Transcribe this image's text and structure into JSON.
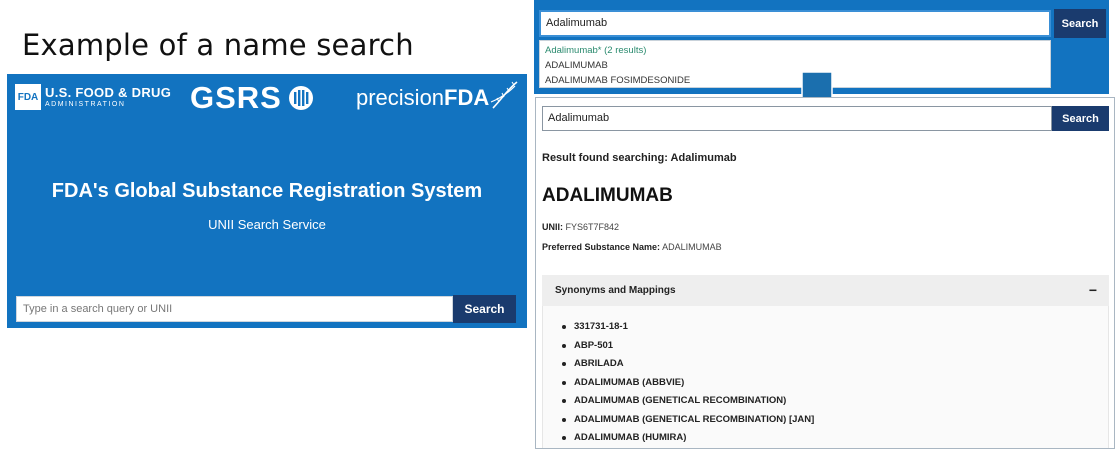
{
  "slide": {
    "title": "Example of a name search"
  },
  "home": {
    "fda_logo": {
      "box": "FDA",
      "line1": "U.S. FOOD & DRUG",
      "line2": "ADMINISTRATION"
    },
    "gsrs_logo": "GSRS",
    "precision_logo": {
      "thin": "precision",
      "bold": "FDA"
    },
    "heading": "FDA's Global Substance Registration System",
    "subheading": "UNII Search Service",
    "search": {
      "placeholder": "Type in a search query or UNII",
      "button": "Search"
    }
  },
  "autocomplete": {
    "query": "Adalimumab",
    "button": "Search",
    "header": "Adalimumab* (2 results)",
    "options": [
      "ADALIMUMAB",
      "ADALIMUMAB FOSIMDESONIDE"
    ]
  },
  "result": {
    "query": "Adalimumab",
    "button": "Search",
    "found_text": "Result found searching: Adalimumab",
    "name": "ADALIMUMAB",
    "unii_label": "UNII:",
    "unii_value": "FYS6T7F842",
    "preferred_label": "Preferred Substance Name:",
    "preferred_value": "ADALIMUMAB",
    "synonyms_title": "Synonyms and Mappings",
    "synonyms_toggle": "−",
    "synonyms": [
      "331731-18-1",
      "ABP-501",
      "ABRILADA",
      "ADALIMUMAB (ABBVIE)",
      "ADALIMUMAB (GENETICAL RECOMBINATION)",
      "ADALIMUMAB (GENETICAL RECOMBINATION) [JAN]",
      "ADALIMUMAB (HUMIRA)"
    ]
  },
  "colors": {
    "brand_blue": "#1273c0",
    "button_navy": "#1a3b6e",
    "arrow_blue": "#1b6fae",
    "autocomplete_header": "#2a8a6e"
  }
}
